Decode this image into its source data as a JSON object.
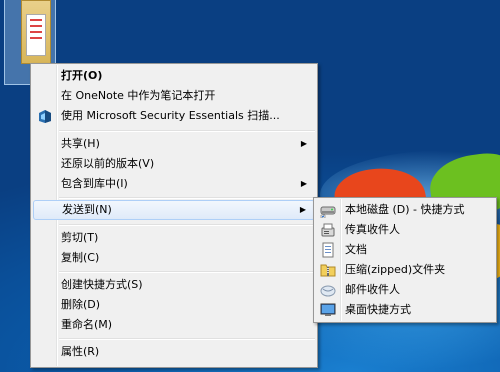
{
  "main_menu": {
    "items": [
      {
        "label": "打开(O)"
      },
      {
        "label": "在 OneNote 中作为笔记本打开"
      },
      {
        "label": "使用 Microsoft Security Essentials 扫描..."
      },
      {
        "label": "共享(H)"
      },
      {
        "label": "还原以前的版本(V)"
      },
      {
        "label": "包含到库中(I)"
      },
      {
        "label": "发送到(N)"
      },
      {
        "label": "剪切(T)"
      },
      {
        "label": "复制(C)"
      },
      {
        "label": "创建快捷方式(S)"
      },
      {
        "label": "删除(D)"
      },
      {
        "label": "重命名(M)"
      },
      {
        "label": "属性(R)"
      }
    ],
    "submenu_arrow": "▶"
  },
  "send_to_menu": {
    "items": [
      {
        "label": "本地磁盘 (D) - 快捷方式",
        "icon": "drive-icon"
      },
      {
        "label": "传真收件人",
        "icon": "fax-icon"
      },
      {
        "label": "文档",
        "icon": "documents-icon"
      },
      {
        "label": "压缩(zipped)文件夹",
        "icon": "zip-folder-icon"
      },
      {
        "label": "邮件收件人",
        "icon": "mail-icon"
      },
      {
        "label": "桌面快捷方式",
        "icon": "desktop-icon"
      }
    ]
  },
  "colors": {
    "menu_bg": "#f0f0f0",
    "highlight_border": "#aecff7",
    "desktop_blue": "#0a4f99"
  }
}
